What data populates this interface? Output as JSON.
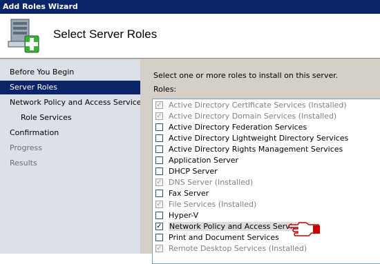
{
  "window": {
    "title": "Add Roles Wizard"
  },
  "header": {
    "title": "Select Server Roles"
  },
  "sidebar": {
    "items": [
      {
        "label": "Before You Begin",
        "state": "normal"
      },
      {
        "label": "Server Roles",
        "state": "active"
      },
      {
        "label": "Network Policy and Access Services",
        "state": "normal"
      },
      {
        "label": "Role Services",
        "state": "normal"
      },
      {
        "label": "Confirmation",
        "state": "normal"
      },
      {
        "label": "Progress",
        "state": "disabled"
      },
      {
        "label": "Results",
        "state": "disabled"
      }
    ]
  },
  "main": {
    "instruction": "Select one or more roles to install on this server.",
    "roles_label": "Roles:",
    "roles": [
      {
        "label": "Active Directory Certificate Services  (Installed)",
        "checked": true,
        "installed": true
      },
      {
        "label": "Active Directory Domain Services  (Installed)",
        "checked": true,
        "installed": true
      },
      {
        "label": "Active Directory Federation Services",
        "checked": false,
        "installed": false
      },
      {
        "label": "Active Directory Lightweight Directory Services",
        "checked": false,
        "installed": false
      },
      {
        "label": "Active Directory Rights Management Services",
        "checked": false,
        "installed": false
      },
      {
        "label": "Application Server",
        "checked": false,
        "installed": false
      },
      {
        "label": "DHCP Server",
        "checked": false,
        "installed": false
      },
      {
        "label": "DNS Server  (Installed)",
        "checked": true,
        "installed": true
      },
      {
        "label": "Fax Server",
        "checked": false,
        "installed": false
      },
      {
        "label": "File Services  (Installed)",
        "checked": true,
        "installed": true
      },
      {
        "label": "Hyper-V",
        "checked": false,
        "installed": false
      },
      {
        "label": "Network Policy and Access Services",
        "checked": true,
        "installed": false,
        "selected": true
      },
      {
        "label": "Print and Document Services",
        "checked": false,
        "installed": false
      },
      {
        "label": "Remote Desktop Services  (Installed)",
        "checked": true,
        "installed": true
      }
    ]
  },
  "colors": {
    "titlebar": "#0a246a",
    "sidebar": "#dbe1e7",
    "accent_red": "#cc0000"
  },
  "icons": {
    "header": "server-add-icon",
    "pointer": "pointing-hand-icon"
  }
}
